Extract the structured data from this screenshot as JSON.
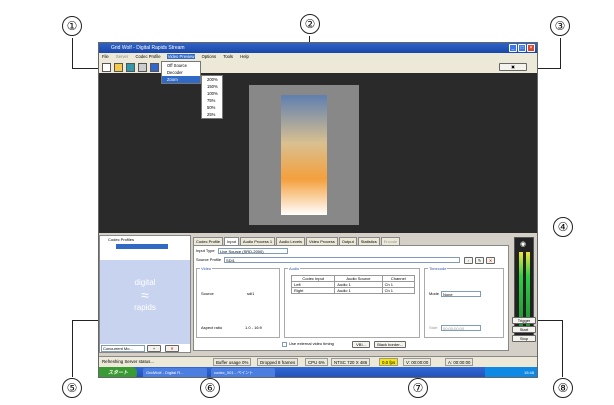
{
  "callouts": [
    "①",
    "②",
    "③",
    "④",
    "⑤",
    "⑥",
    "⑦",
    "⑧"
  ],
  "window": {
    "title": "Grid Wolf - Digital Rapids Stream"
  },
  "menu": [
    "File",
    "Server",
    "Codec Profile",
    "Video Preview",
    "Options",
    "Tools",
    "Help"
  ],
  "preview_menu": {
    "items": [
      "Off Source",
      "Decoder",
      "Zoom"
    ]
  },
  "zoom_menu": {
    "items": [
      "200%",
      "150%",
      "100%",
      "75%",
      "50%",
      "25%"
    ]
  },
  "toolbar_right_label": "",
  "left_panel": {
    "header": "Codec Profiles",
    "selected": "",
    "logo_lines": [
      "digital",
      "rapids"
    ]
  },
  "tabs": [
    "Codec Profile",
    "Input",
    "Audio Process 1",
    "Audio Levels",
    "Video Process",
    "Output",
    "Statistics",
    "Encode"
  ],
  "input": {
    "input_type_label": "Input Type",
    "input_type_value": "Live Source (SRD-2000)",
    "source_profile_label": "Source Profile",
    "source_profile_value": "SDI1",
    "video_title": "Video",
    "source_label": "Source",
    "source_value": "sdi1",
    "aspect_label": "Aspect ratio",
    "aspect_value": "1.0 - 16:9",
    "audio_title": "Audio",
    "audio_headers": [
      "Codec Input",
      "Audio Source",
      "Channel"
    ],
    "audio_rows": [
      [
        "Left",
        "Audio 1",
        "Ch 1"
      ],
      [
        "Right",
        "Audio 1",
        "Ch 1"
      ]
    ],
    "timecode_title": "Timecode",
    "mode_label": "Mode",
    "mode_value": "None",
    "start_label": "Start",
    "start_value": "00:00:00:00",
    "ext_trigger_label": "Use external video timing",
    "vbi_button": "VBI...",
    "black_border_button": "Black border..."
  },
  "left_bottom": {
    "select_value": "Concurrent Mo...",
    "add": "+",
    "remove": "✕"
  },
  "status": {
    "message": "Refreshing Server status...",
    "buffer": "Buffer usage 0%",
    "dropped": "Dropped 8 frames",
    "cpu": "CPU 6%",
    "format": "NTSC 720 X 486",
    "fps": "0.0 fps",
    "timecode_v": "V: 00:00:00",
    "timecode_a": "A: 00:00:00"
  },
  "right_buttons": [
    "Trigger",
    "Start",
    "Stop"
  ],
  "taskbar": {
    "start": "スタート",
    "tasks": [
      "GridWolf - Digital R...",
      "codec_001 - ペイント"
    ],
    "clock": "15:48"
  },
  "colors": {
    "title": "#2f63c7",
    "fps_highlight": "#f7e600",
    "meter": "#2fcf43"
  }
}
